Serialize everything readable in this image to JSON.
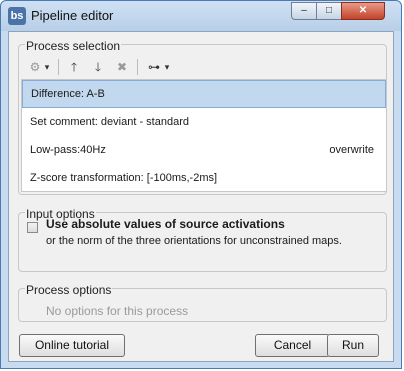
{
  "window": {
    "title": "Pipeline editor",
    "app_icon_text": "bs",
    "minimize_glyph": "–",
    "maximize_glyph": "□",
    "close_glyph": "✕"
  },
  "process_selection": {
    "title": "Process selection",
    "toolbar": {
      "gear_glyph": "⚙",
      "dropdown_glyph": "▾",
      "up_glyph": "🡑",
      "down_glyph": "🡓",
      "delete_glyph": "✖",
      "tree_glyph": "⊶"
    },
    "items": [
      {
        "label": "Difference: A-B",
        "extra": "",
        "selected": true
      },
      {
        "label": "Set comment: deviant - standard",
        "extra": "",
        "selected": false
      },
      {
        "label": "Low-pass:40Hz",
        "extra": "overwrite",
        "selected": false
      },
      {
        "label": "Z-score transformation: [-100ms,-2ms]",
        "extra": "",
        "selected": false
      }
    ]
  },
  "input_options": {
    "title": "Input options",
    "checkbox_label": "Use absolute values of source activations",
    "checkbox_sub": "or the norm of the three orientations for unconstrained maps."
  },
  "process_options": {
    "title": "Process options",
    "placeholder": "No options for this process"
  },
  "buttons": {
    "tutorial": "Online tutorial",
    "cancel": "Cancel",
    "run": "Run"
  }
}
